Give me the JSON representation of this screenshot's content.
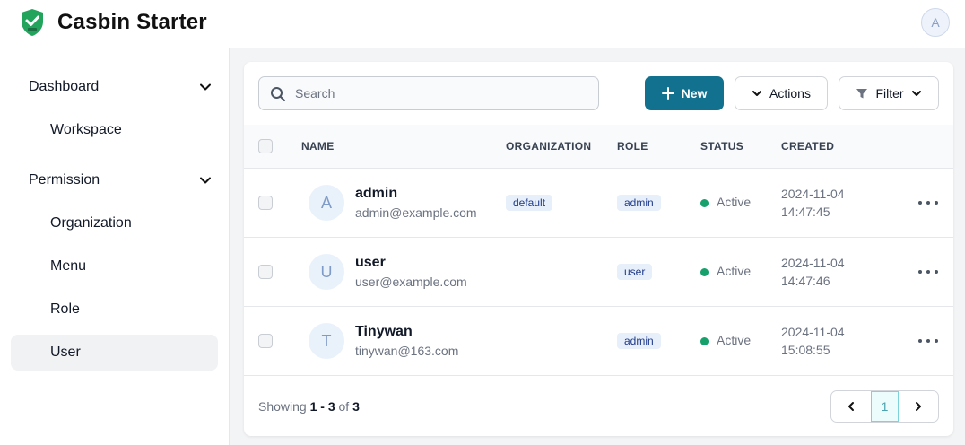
{
  "header": {
    "app_title": "Casbin Starter",
    "logo_icon": "shield-check-icon",
    "user_avatar_initial": "A"
  },
  "sidebar": {
    "groups": [
      {
        "label": "Dashboard",
        "expanded": true,
        "items": [
          {
            "label": "Workspace",
            "active": false
          }
        ]
      },
      {
        "label": "Permission",
        "expanded": true,
        "items": [
          {
            "label": "Organization",
            "active": false
          },
          {
            "label": "Menu",
            "active": false
          },
          {
            "label": "Role",
            "active": false
          },
          {
            "label": "User",
            "active": true
          }
        ]
      }
    ]
  },
  "toolbar": {
    "search_placeholder": "Search",
    "search_value": "",
    "new_label": "New",
    "actions_label": "Actions",
    "filter_label": "Filter"
  },
  "table": {
    "columns": [
      "NAME",
      "ORGANIZATION",
      "ROLE",
      "STATUS",
      "CREATED"
    ],
    "rows": [
      {
        "initial": "A",
        "name": "admin",
        "email": "admin@example.com",
        "organization": "default",
        "role": "admin",
        "status": "Active",
        "created_date": "2024-11-04",
        "created_time": "14:47:45"
      },
      {
        "initial": "U",
        "name": "user",
        "email": "user@example.com",
        "organization": "",
        "role": "user",
        "status": "Active",
        "created_date": "2024-11-04",
        "created_time": "14:47:46"
      },
      {
        "initial": "T",
        "name": "Tinywan",
        "email": "tinywan@163.com",
        "organization": "",
        "role": "admin",
        "status": "Active",
        "created_date": "2024-11-04",
        "created_time": "15:08:55"
      }
    ]
  },
  "footer": {
    "showing_prefix": "Showing",
    "range": "1 - 3",
    "of_label": "of",
    "total": "3",
    "current_page": "1"
  },
  "colors": {
    "primary": "#11718f",
    "active_status": "#16a06b",
    "logo_green": "#22a45d",
    "badge_bg": "#e7effa"
  }
}
